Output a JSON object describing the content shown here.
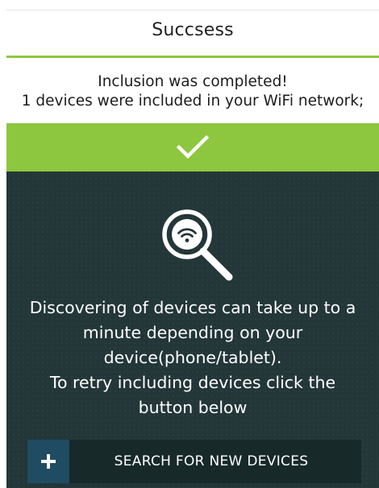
{
  "header": {
    "title": "Succsess"
  },
  "message": {
    "line1": "Inclusion was completed!",
    "line2": "1 devices were included in your WiFi network;"
  },
  "status": {
    "icon": "checkmark-icon"
  },
  "panel": {
    "illustration_icon": "wifi-search-icon",
    "info_lines": [
      "Discovering of devices can take up to a",
      "minute depending on your",
      "device(phone/tablet).",
      "To retry including devices click the",
      "button below"
    ],
    "search_button": {
      "icon": "plus-icon",
      "label": "SEARCH FOR NEW DEVICES"
    }
  },
  "colors": {
    "accent_green": "#8dc63f",
    "panel_dark": "#233638",
    "button_dark": "#18292a",
    "plus_blue": "#1f4c63"
  }
}
